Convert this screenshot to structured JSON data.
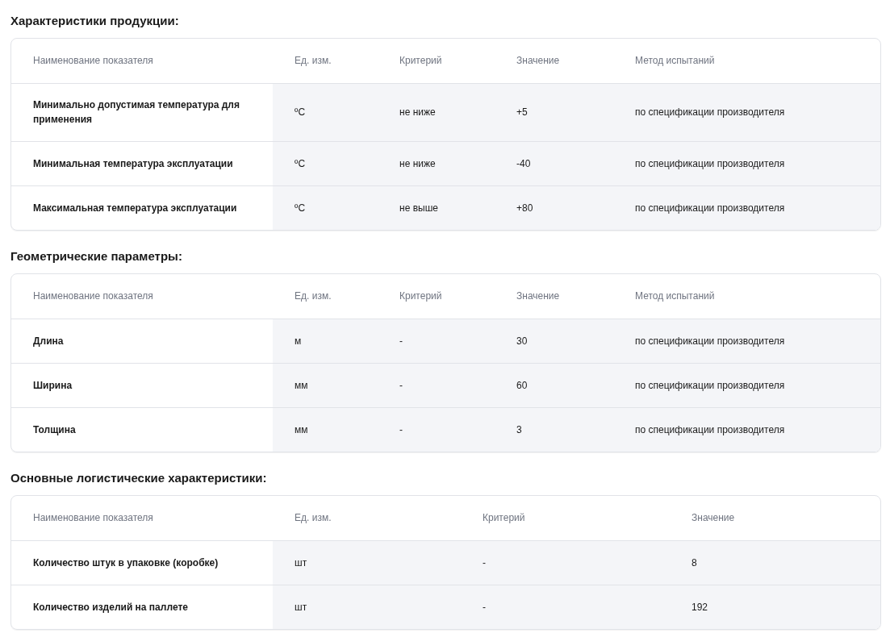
{
  "sections": [
    {
      "title": "Характеристики продукции:",
      "columns": [
        "Наименование показателя",
        "Ед. изм.",
        "Критерий",
        "Значение",
        "Метод испытаний"
      ],
      "rows": [
        [
          "Минимально допустимая температура для применения",
          "ºС",
          "не ниже",
          "+5",
          "по спецификации производителя"
        ],
        [
          "Минимальная температура эксплуатации",
          "ºС",
          "не ниже",
          "-40",
          "по спецификации производителя"
        ],
        [
          "Максимальная температура эксплуатации",
          "ºС",
          "не выше",
          "+80",
          "по спецификации производителя"
        ]
      ]
    },
    {
      "title": "Геометрические параметры:",
      "columns": [
        "Наименование показателя",
        "Ед. изм.",
        "Критерий",
        "Значение",
        "Метод испытаний"
      ],
      "rows": [
        [
          "Длина",
          "м",
          "-",
          "30",
          "по спецификации производителя"
        ],
        [
          "Ширина",
          "мм",
          "-",
          "60",
          "по спецификации производителя"
        ],
        [
          "Толщина",
          "мм",
          "-",
          "3",
          "по спецификации производителя"
        ]
      ]
    },
    {
      "title": "Основные логистические характеристики:",
      "columns": [
        "Наименование показателя",
        "Ед. изм.",
        "Критерий",
        "Значение"
      ],
      "rows": [
        [
          "Количество штук в упаковке (коробке)",
          "шт",
          "-",
          "8"
        ],
        [
          "Количество изделий на паллете",
          "шт",
          "-",
          "192"
        ]
      ]
    }
  ]
}
